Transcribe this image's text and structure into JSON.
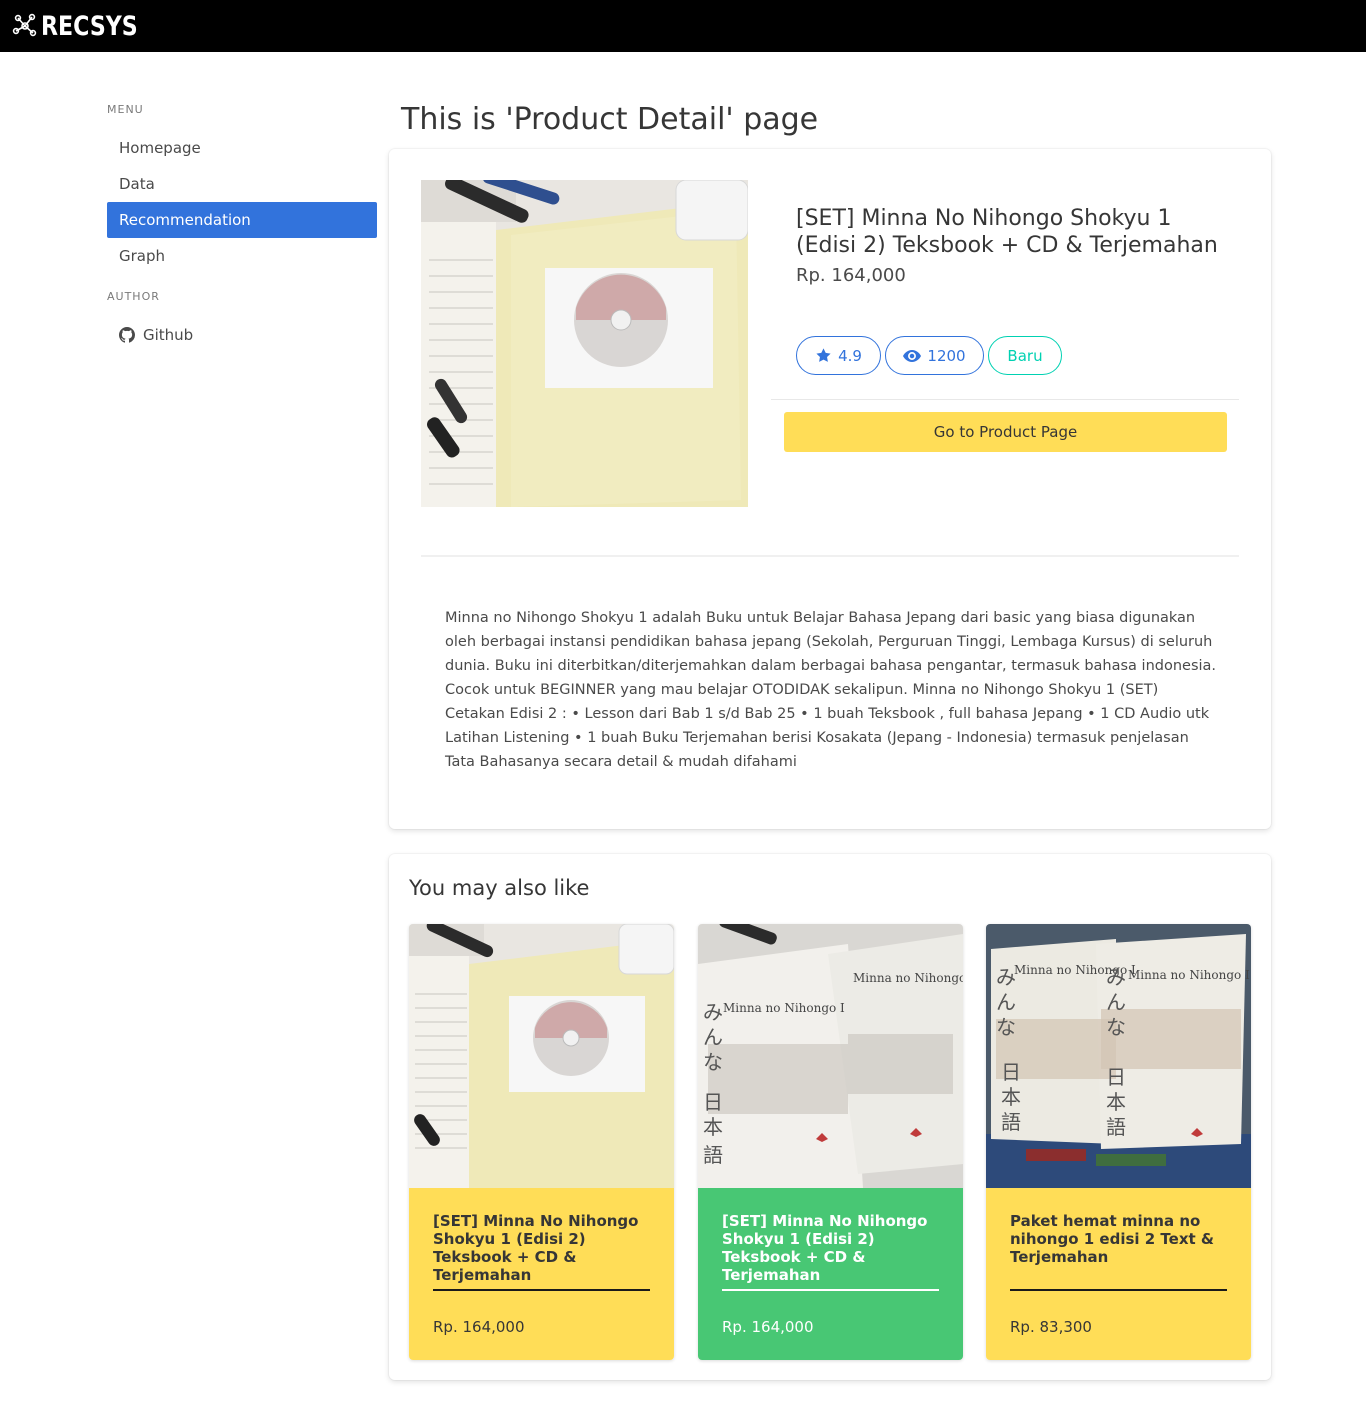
{
  "brand": {
    "name": "RECSYS"
  },
  "sidebar": {
    "menu_label": "MENU",
    "items": [
      {
        "label": "Homepage"
      },
      {
        "label": "Data"
      },
      {
        "label": "Recommendation"
      },
      {
        "label": "Graph"
      }
    ],
    "author_label": "AUTHOR",
    "github_label": "Github"
  },
  "page": {
    "title": "This is 'Product Detail' page"
  },
  "product": {
    "title": "[SET] Minna No Nihongo Shokyu 1 (Edisi 2) Teksbook + CD & Terjemahan",
    "price": "Rp. 164,000",
    "rating": "4.9",
    "views": "1200",
    "condition": "Baru",
    "button_label": "Go to Product Page",
    "description": "Minna no Nihongo Shokyu 1 adalah Buku untuk Belajar Bahasa Jepang dari basic yang biasa digunakan oleh berbagai instansi pendidikan bahasa jepang (Sekolah, Perguruan Tinggi, Lembaga Kursus) di seluruh dunia. Buku ini diterbitkan/diterjemahkan dalam berbagai bahasa pengantar, termasuk bahasa indonesia. Cocok untuk BEGINNER yang mau belajar OTODIDAK sekalipun. Minna no Nihongo Shokyu 1 (SET) Cetakan Edisi 2 : • Lesson dari Bab 1 s/d Bab 25 • 1 buah Teksbook , full bahasa Jepang • 1 CD Audio utk Latihan Listening • 1 buah Buku Terjemahan berisi Kosakata (Jepang - Indonesia) termasuk penjelasan Tata Bahasanya secara detail & mudah difahami"
  },
  "recommendations": {
    "title": "You may also like",
    "items": [
      {
        "title": "[SET] Minna No Nihongo Shokyu 1 (Edisi 2) Teksbook + CD & Terjemahan",
        "price": "Rp. 164,000",
        "color": "#ffdd57"
      },
      {
        "title": "[SET] Minna No Nihongo Shokyu 1 (Edisi 2) Teksbook + CD & Terjemahan",
        "price": "Rp. 164,000",
        "color": "#48c774"
      },
      {
        "title": "Paket hemat minna no nihongo 1 edisi 2 Text & Terjemahan",
        "price": "Rp. 83,300",
        "color": "#ffdd57"
      }
    ]
  },
  "colors": {
    "primary": "#3273dc",
    "warning": "#ffdd57",
    "success": "#48c774",
    "info": "#00d1b2"
  },
  "icons": {
    "brand": "network-icon",
    "github": "github-icon",
    "rating": "star-icon",
    "views": "eye-icon"
  }
}
